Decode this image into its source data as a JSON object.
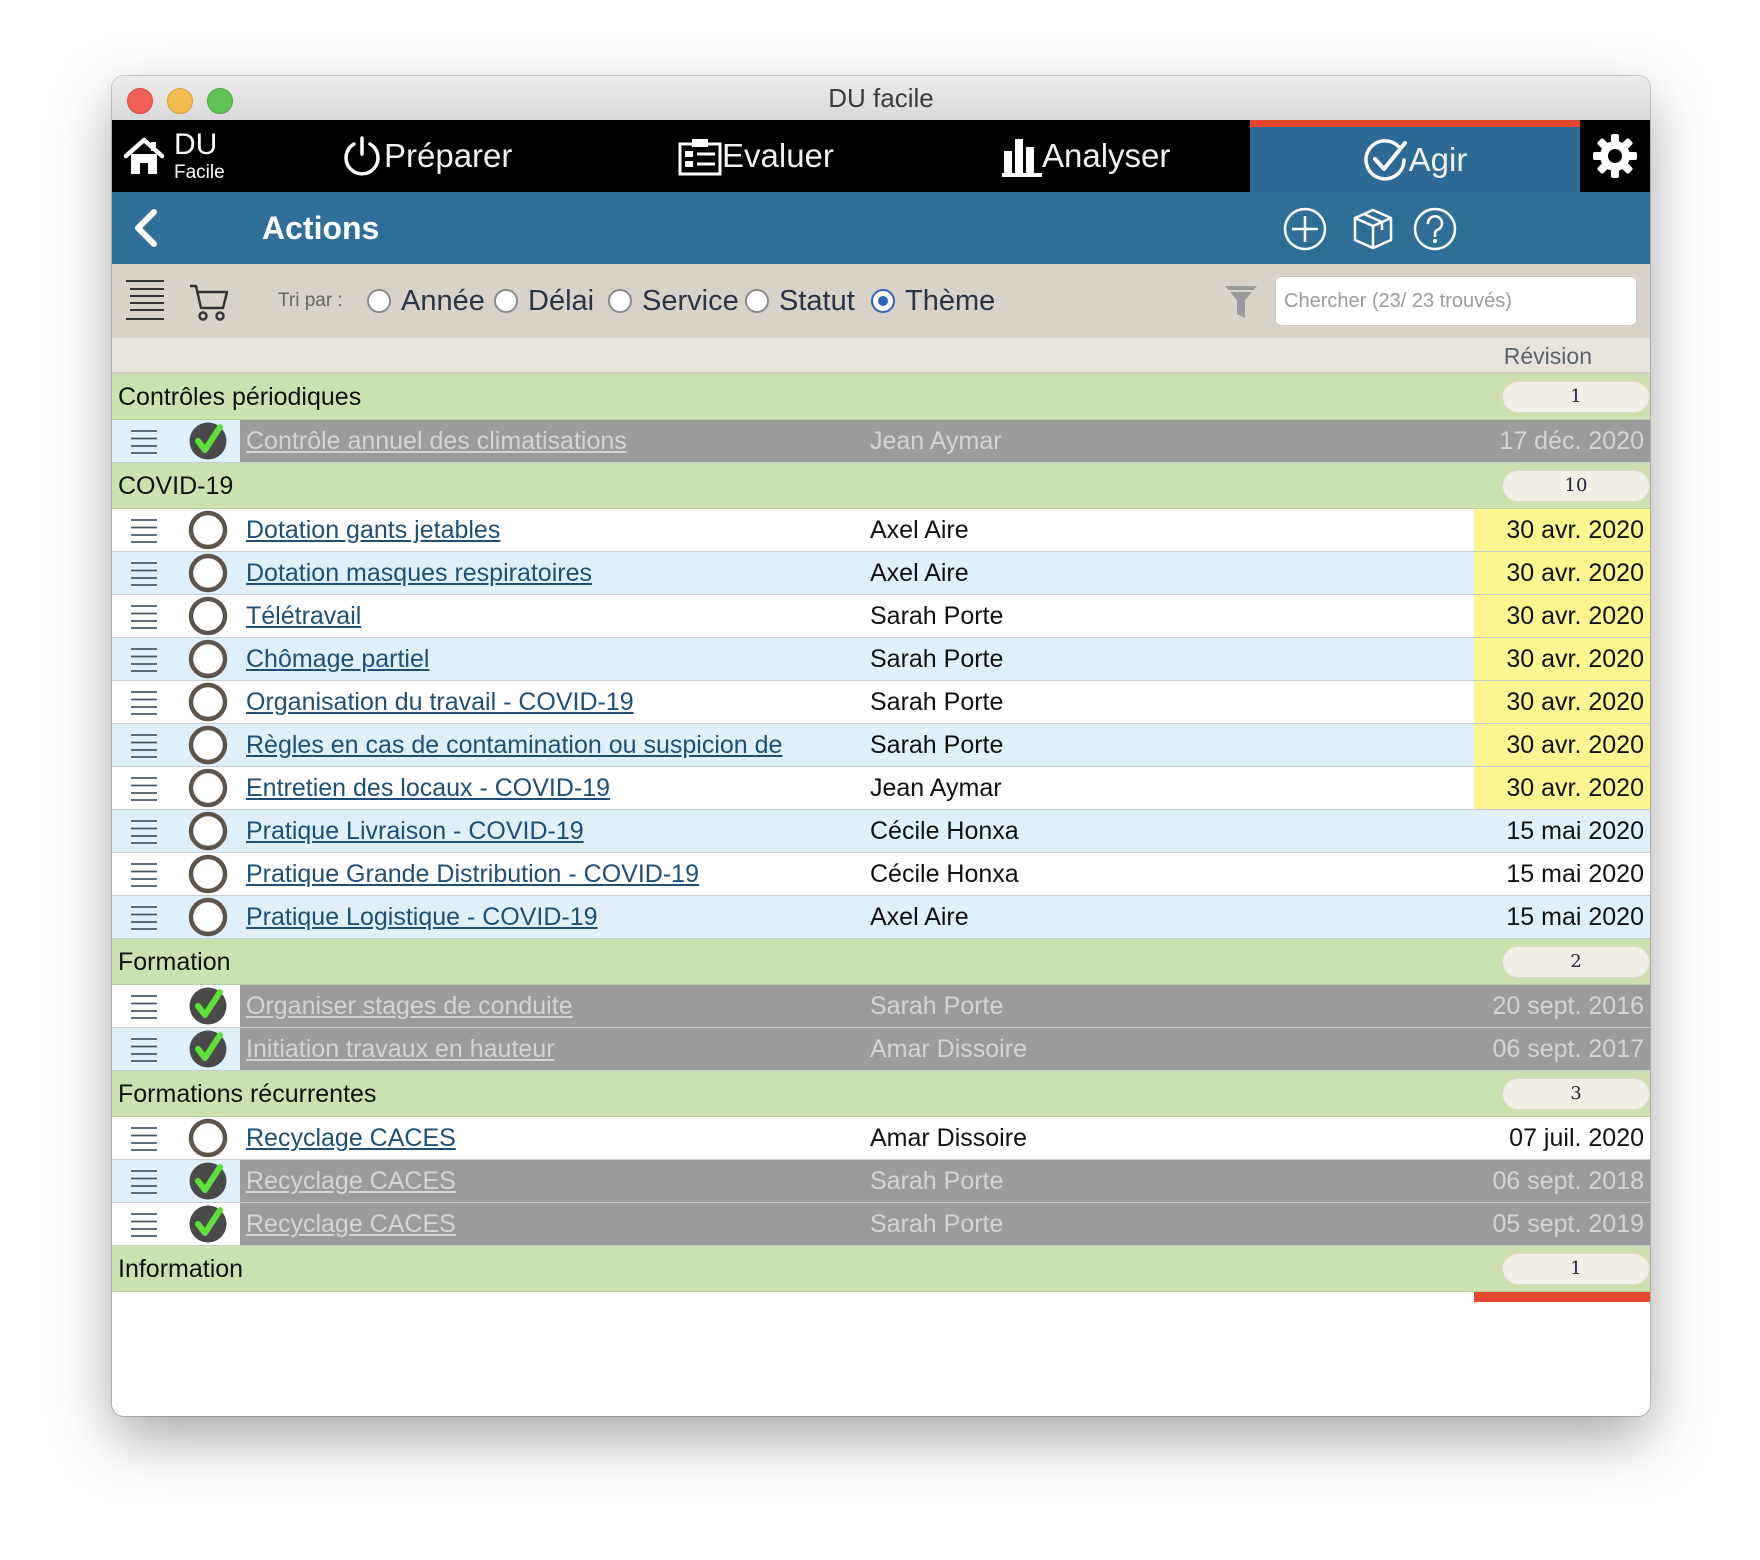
{
  "window": {
    "title": "DU facile"
  },
  "nav": {
    "home_big": "DU",
    "home_small": "Facile",
    "tabs": [
      "Préparer",
      "Evaluer",
      "Analyser",
      "Agir"
    ]
  },
  "header": {
    "title": "Actions"
  },
  "filter": {
    "sort_label": "Tri par :",
    "options": [
      "Année",
      "Délai",
      "Service",
      "Statut",
      "Thème"
    ],
    "selected": "Thème",
    "search_placeholder": "Chercher (23/ 23 trouvés)"
  },
  "columns": {
    "revision": "Révision"
  },
  "groups": [
    {
      "name": "Contrôles périodiques",
      "count": "1",
      "rows": [
        {
          "title": "Contrôle annuel des climatisations",
          "person": "Jean Aymar",
          "date": "17 déc. 2020",
          "done": true
        }
      ]
    },
    {
      "name": "COVID-19",
      "count": "10",
      "rows": [
        {
          "title": "Dotation gants jetables",
          "person": "Axel Aire",
          "date": "30 avr. 2020",
          "done": false,
          "overdue": true
        },
        {
          "title": "Dotation masques respiratoires",
          "person": "Axel Aire",
          "date": "30 avr. 2020",
          "done": false,
          "overdue": true
        },
        {
          "title": "Télétravail",
          "person": "Sarah Porte",
          "date": "30 avr. 2020",
          "done": false,
          "overdue": true
        },
        {
          "title": "Chômage partiel",
          "person": "Sarah Porte",
          "date": "30 avr. 2020",
          "done": false,
          "overdue": true
        },
        {
          "title": "Organisation du travail - COVID-19",
          "person": "Sarah Porte",
          "date": "30 avr. 2020",
          "done": false,
          "overdue": true
        },
        {
          "title": "Règles en cas de contamination ou suspicion de",
          "person": "Sarah Porte",
          "date": "30 avr. 2020",
          "done": false,
          "overdue": true
        },
        {
          "title": "Entretien des locaux - COVID-19",
          "person": "Jean Aymar",
          "date": "30 avr. 2020",
          "done": false,
          "overdue": true
        },
        {
          "title": "Pratique Livraison - COVID-19",
          "person": "Cécile Honxa",
          "date": "15 mai 2020",
          "done": false
        },
        {
          "title": "Pratique Grande Distribution - COVID-19",
          "person": "Cécile Honxa",
          "date": "15 mai 2020",
          "done": false
        },
        {
          "title": "Pratique Logistique - COVID-19",
          "person": "Axel Aire",
          "date": "15 mai 2020",
          "done": false
        }
      ]
    },
    {
      "name": "Formation",
      "count": "2",
      "rows": [
        {
          "title": "Organiser stages de conduite",
          "person": "Sarah Porte",
          "date": "20 sept. 2016",
          "done": true
        },
        {
          "title": "Initiation travaux en hauteur",
          "person": "Amar Dissoire",
          "date": "06 sept. 2017",
          "done": true
        }
      ]
    },
    {
      "name": "Formations récurrentes",
      "count": "3",
      "rows": [
        {
          "title": "Recyclage CACES",
          "person": "Amar Dissoire",
          "date": "07 juil. 2020",
          "done": false
        },
        {
          "title": "Recyclage CACES",
          "person": "Sarah Porte",
          "date": "06 sept. 2018",
          "done": true
        },
        {
          "title": "Recyclage CACES",
          "person": "Sarah Porte",
          "date": "05 sept. 2019",
          "done": true
        }
      ]
    },
    {
      "name": "Information",
      "count": "1",
      "rows": []
    }
  ],
  "colors": {
    "nav_active": "#2e6a96",
    "header_bar": "#2f6e97",
    "group_band": "#cbe2b0",
    "overdue": "#fdf58f",
    "done_band": "#9b9b9b",
    "link": "#1d4f78",
    "accent_red": "#e8472f"
  }
}
